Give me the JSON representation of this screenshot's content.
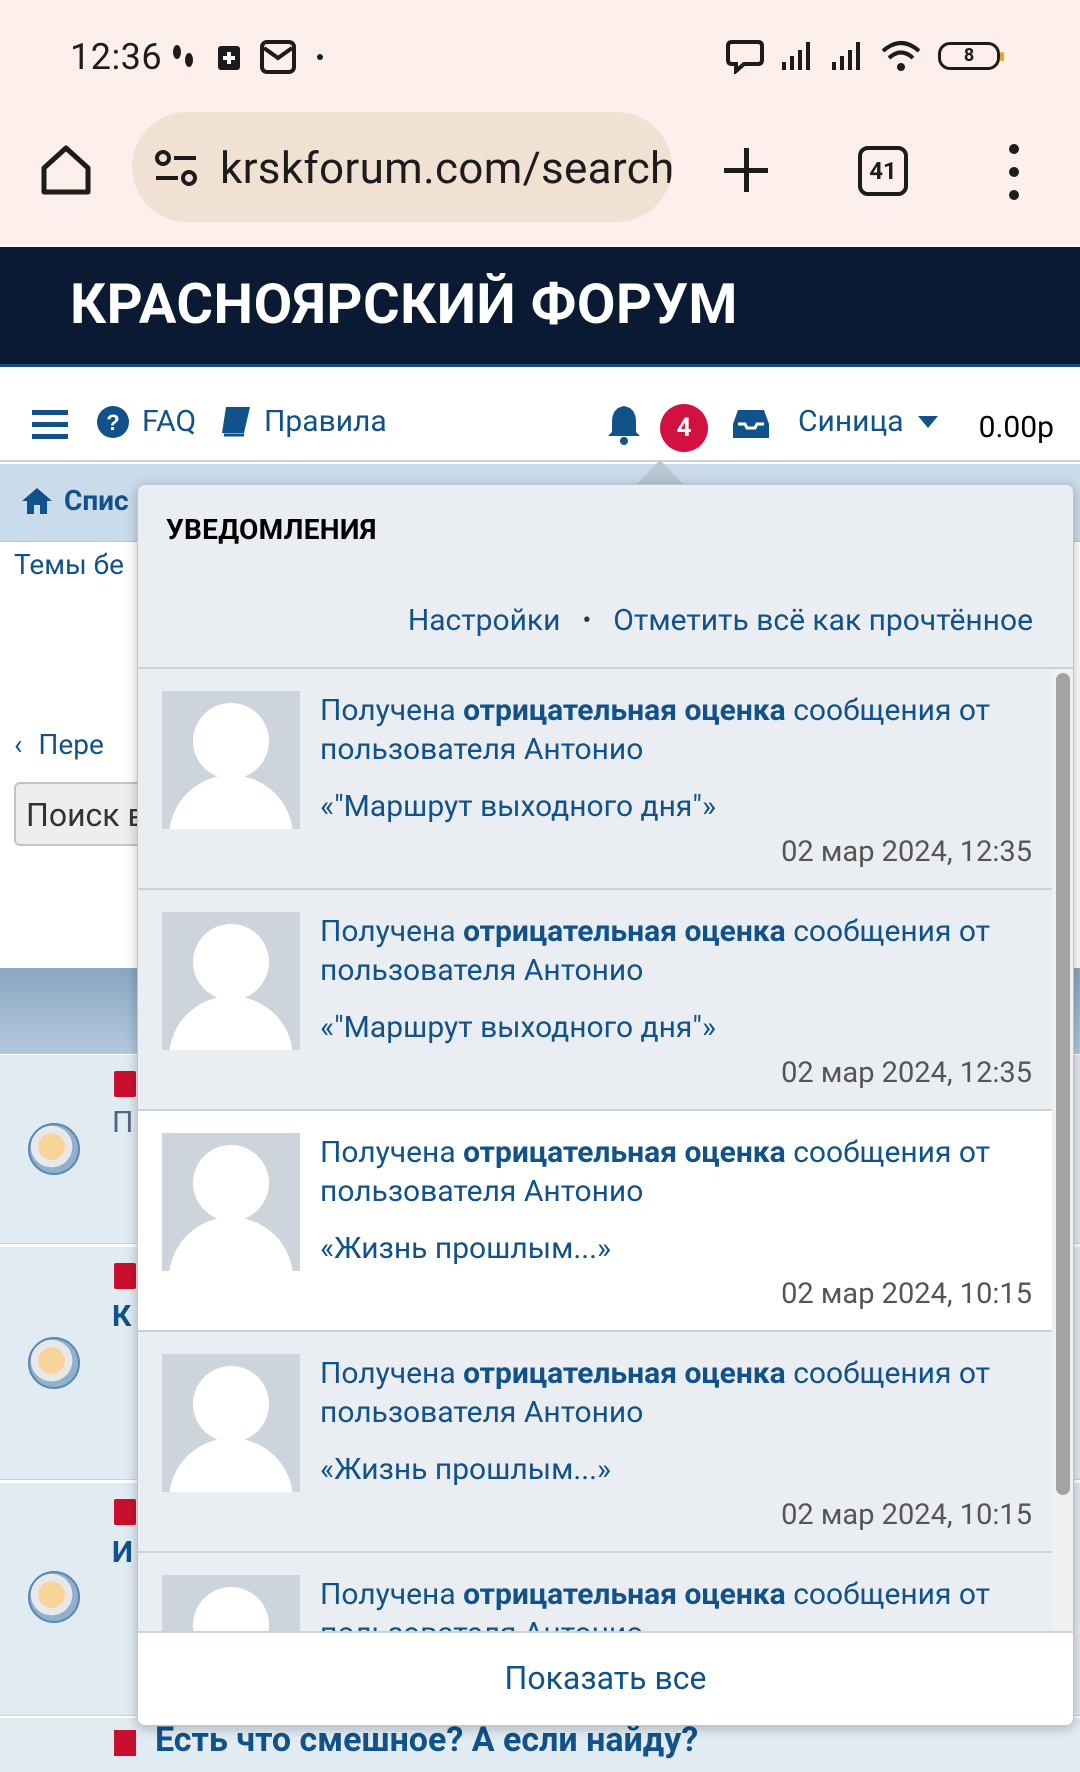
{
  "status_bar": {
    "time": "12:36",
    "battery": "8"
  },
  "browser": {
    "url": "krskforum.com/search",
    "tab_count": "41"
  },
  "site": {
    "title": "КРАСНОЯРСКИЙ ФОРУМ"
  },
  "navbar": {
    "faq": "FAQ",
    "rules": "Правила",
    "notification_count": "4",
    "username": "Синица",
    "credits": "0.00р"
  },
  "background": {
    "breadcrumb": "Спис",
    "topics_line": "Темы бе",
    "nav_line": "Пере",
    "search_placeholder": "Поиск в",
    "row_letters": [
      "П",
      "К",
      "И"
    ],
    "last_topic": "Есть что смешное? А если найду?"
  },
  "notifications": {
    "title": "УВЕДОМЛЕНИЯ",
    "settings": "Настройки",
    "separator": "•",
    "mark_all_read": "Отметить всё как прочтённое",
    "show_all": "Показать все",
    "items": [
      {
        "prefix": "Получена",
        "bold": "отрицательная оценка",
        "suffix": "сообщения от пользователя Антонио",
        "ref": "«\"Маршрут выходного дня\"»",
        "time": "02 мар 2024, 12:35"
      },
      {
        "prefix": "Получена",
        "bold": "отрицательная оценка",
        "suffix": "сообщения от пользователя Антонио",
        "ref": "«\"Маршрут выходного дня\"»",
        "time": "02 мар 2024, 12:35"
      },
      {
        "prefix": "Получена",
        "bold": "отрицательная оценка",
        "suffix": "сообщения от пользователя Антонио",
        "ref": "«Жизнь прошлым...»",
        "time": "02 мар 2024, 10:15"
      },
      {
        "prefix": "Получена",
        "bold": "отрицательная оценка",
        "suffix": "сообщения от пользователя Антонио",
        "ref": "«Жизнь прошлым...»",
        "time": "02 мар 2024, 10:15"
      },
      {
        "prefix": "Получена",
        "bold": "отрицательная оценка",
        "suffix": "сообщения от пользователя Антонио",
        "ref": "",
        "time": ""
      }
    ]
  },
  "colors": {
    "link": "#105289",
    "header_bg": "#0b1a33",
    "badge": "#d31141",
    "panel_bg": "#eaedf1"
  }
}
